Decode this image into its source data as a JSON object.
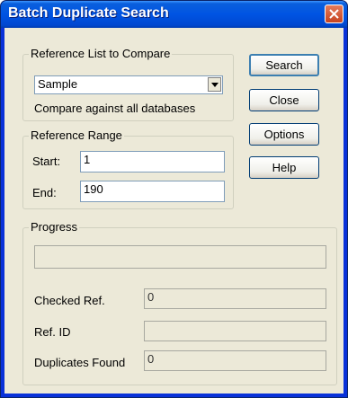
{
  "window": {
    "title": "Batch Duplicate Search"
  },
  "reference_list": {
    "group_label": "Reference List to Compare",
    "selected": "Sample",
    "note": "Compare against all databases"
  },
  "reference_range": {
    "group_label": "Reference Range",
    "start_label": "Start:",
    "start_value": "1",
    "end_label": "End:",
    "end_value": "190"
  },
  "buttons": {
    "search": "Search",
    "close": "Close",
    "options": "Options",
    "help": "Help"
  },
  "progress": {
    "group_label": "Progress",
    "bar_value": 0,
    "checked_label": "Checked Ref.",
    "checked_value": "0",
    "refid_label": "Ref. ID",
    "refid_value": "",
    "dups_label": "Duplicates Found",
    "dups_value": "0"
  },
  "icons": {
    "close": "close-icon",
    "dropdown": "chevron-down-icon"
  }
}
